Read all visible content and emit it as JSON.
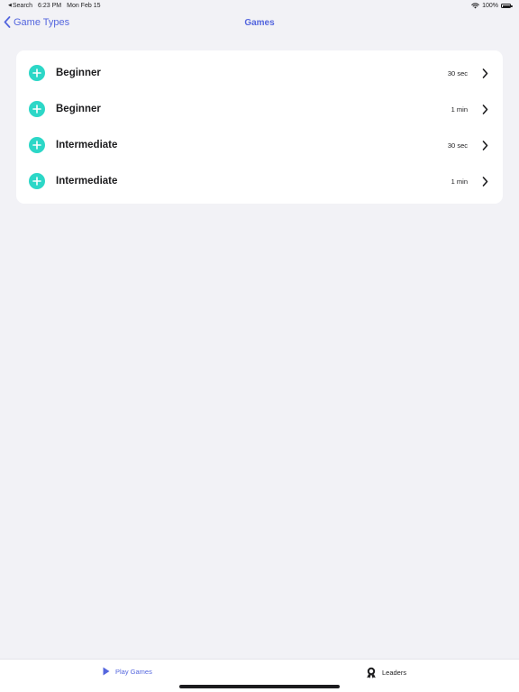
{
  "status_bar": {
    "back_app": "Search",
    "time": "6:23 PM",
    "date": "Mon Feb 15",
    "battery": "100%"
  },
  "nav": {
    "back_label": "Game Types",
    "title": "Games"
  },
  "games": [
    {
      "level": "Beginner",
      "duration": "30 sec"
    },
    {
      "level": "Beginner",
      "duration": "1 min"
    },
    {
      "level": "Intermediate",
      "duration": "30 sec"
    },
    {
      "level": "Intermediate",
      "duration": "1 min"
    }
  ],
  "tab_bar": {
    "play_label": "Play Games",
    "leaders_label": "Leaders"
  },
  "colors": {
    "accent": "#5466de",
    "add_button": "#2cd7c7",
    "background": "#f2f2f6"
  },
  "icons": {
    "back": "chevron-left-icon",
    "add": "plus-circle-icon",
    "disclosure": "chevron-right-icon",
    "play": "play-icon",
    "leaders": "award-icon",
    "wifi": "wifi-icon",
    "battery": "battery-icon"
  }
}
